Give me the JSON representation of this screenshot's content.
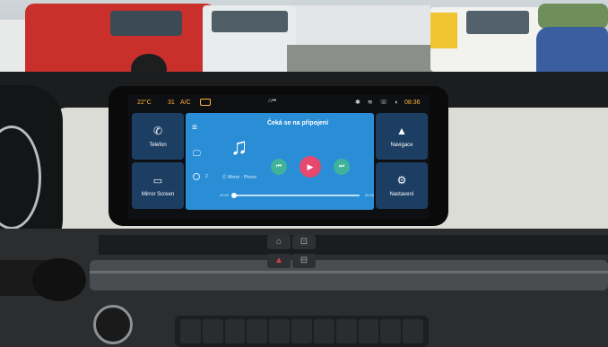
{
  "status_bar": {
    "temperature": "22°C",
    "fan_level": "31",
    "ac_label": "A/C",
    "time": "08:36"
  },
  "sidebar_left": [
    {
      "label": "Telefon",
      "icon": "phone-icon"
    },
    {
      "label": "Mirror Screen",
      "icon": "mirror-screen-icon"
    }
  ],
  "sidebar_right": [
    {
      "label": "Navigace",
      "icon": "navigation-arrow-icon"
    },
    {
      "label": "Nastavení",
      "icon": "settings-gear-icon"
    }
  ],
  "media": {
    "title": "Čeká se na připojení",
    "source_label": "2",
    "source_name": "Ⓔ Mirror · Phone",
    "time_start": "00:00",
    "time_end": "00:00",
    "progress": 0
  },
  "colors": {
    "accent_orange": "#ffb43a",
    "app_blue": "#2a8ed6",
    "sidebar_blue": "#1d3e63",
    "play_pink": "#e6496d",
    "skip_green": "#3fb39a"
  }
}
